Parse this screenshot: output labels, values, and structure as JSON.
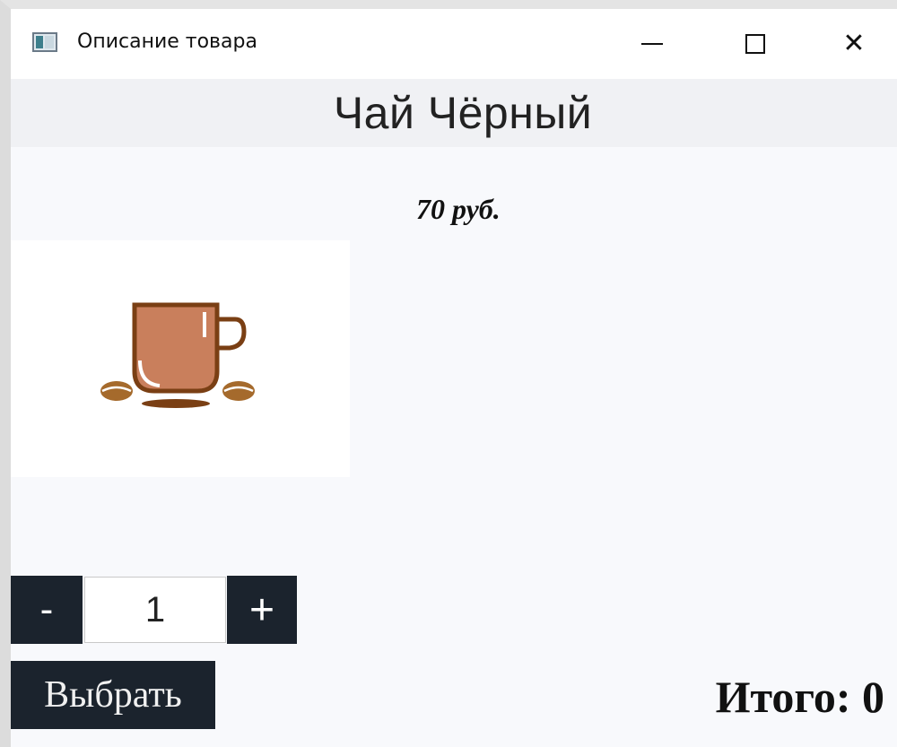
{
  "window": {
    "title": "Описание товара",
    "controls": {
      "minimize": "minimize-icon",
      "maximize": "maximize-icon",
      "close": "✕"
    }
  },
  "product": {
    "title": "Чай Чёрный",
    "price": "70 руб.",
    "image_icon": "tea-cup-icon"
  },
  "stepper": {
    "minus_label": "-",
    "quantity": "1",
    "plus_label": "+"
  },
  "actions": {
    "select_label": "Выбрать"
  },
  "summary": {
    "total": "Итого: 0"
  },
  "colors": {
    "button_bg": "#1b232d",
    "background": "#f8f9fc",
    "header_band": "#f0f1f4",
    "cup": "#c97f5c",
    "cup_outline": "#7a3f14",
    "beans": "#a56a2c"
  }
}
